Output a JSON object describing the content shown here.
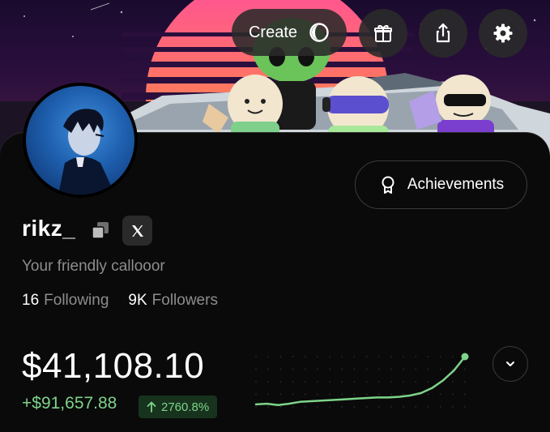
{
  "header": {
    "create_label": "Create",
    "icons": [
      "coin-icon",
      "gift-icon",
      "share-icon",
      "gear-icon"
    ]
  },
  "profile": {
    "username": "rikz_",
    "bio": "Your friendly callooor",
    "following_count": "16",
    "following_label": "Following",
    "followers_count": "9K",
    "followers_label": "Followers",
    "achievements_label": "Achievements"
  },
  "portfolio": {
    "balance": "$41,108.10",
    "gain": "+$91,657.88",
    "gain_percent": "2760.8%",
    "gain_color": "#7ed48a"
  },
  "chart_data": {
    "type": "line",
    "series": [
      {
        "values": [
          0.04,
          0.05,
          0.03,
          0.05,
          0.08,
          0.09,
          0.1,
          0.11,
          0.12,
          0.13,
          0.14,
          0.15,
          0.15,
          0.16,
          0.18,
          0.22,
          0.3,
          0.42,
          0.58,
          0.8
        ]
      }
    ],
    "color": "#7ed48a",
    "grid": "dotted"
  }
}
